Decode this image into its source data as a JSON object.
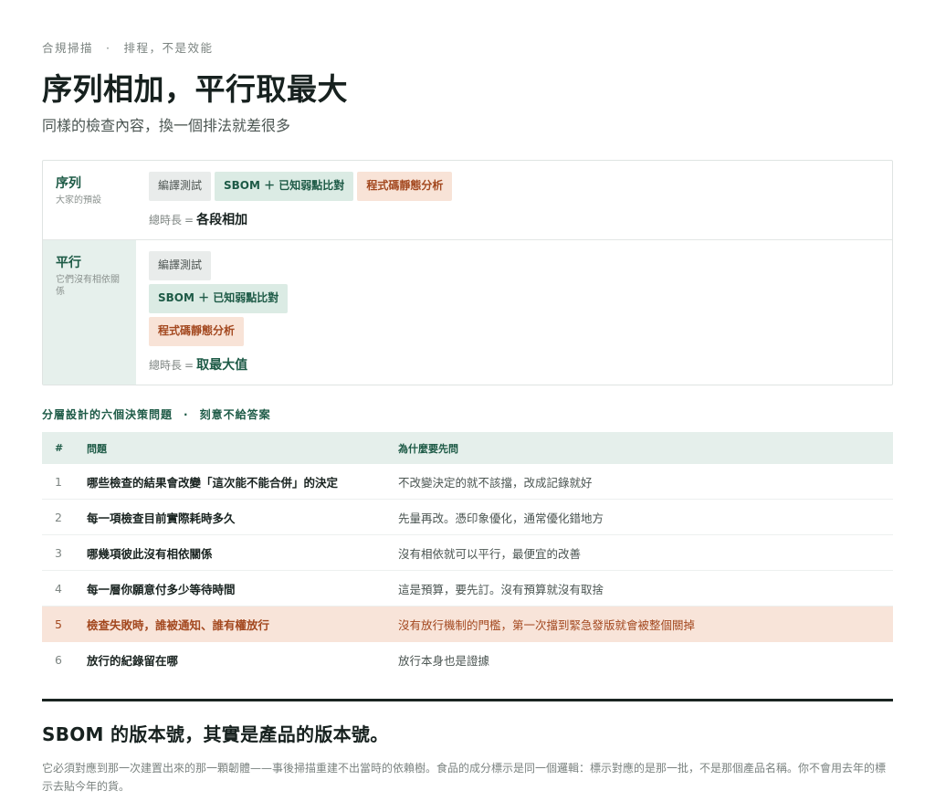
{
  "eyebrow": {
    "left": "合規掃描",
    "separator": "·",
    "right": "排程，不是效能"
  },
  "title": "序列相加，平行取最大",
  "subtitle": "同樣的檢查內容，換一個排法就差很多",
  "comparison": {
    "serial": {
      "label": "序列",
      "sublabel": "大家的預設",
      "chips": [
        "編譯測試",
        "SBOM ＋ 已知弱點比對",
        "程式碼靜態分析"
      ],
      "total_prefix": "總時長",
      "total_eq": "=",
      "total_value": "各段相加"
    },
    "parallel": {
      "label": "平行",
      "sublabel": "它們沒有相依關係",
      "chips": [
        "編譯測試",
        "SBOM ＋ 已知弱點比對",
        "程式碼靜態分析"
      ],
      "total_prefix": "總時長",
      "total_eq": "=",
      "total_value": "取最大值"
    }
  },
  "questions": {
    "heading_left": "分層設計的六個決策問題",
    "heading_sep": "·",
    "heading_right": "刻意不給答案",
    "columns": [
      "#",
      "問題",
      "為什麼要先問"
    ],
    "rows": [
      {
        "num": "1",
        "question": "哪些檢查的結果會改變「這次能不能合併」的決定",
        "why": "不改變決定的就不該擋，改成記錄就好"
      },
      {
        "num": "2",
        "question": "每一項檢查目前實際耗時多久",
        "why": "先量再改。憑印象優化，通常優化錯地方"
      },
      {
        "num": "3",
        "question": "哪幾項彼此沒有相依關係",
        "why": "沒有相依就可以平行，最便宜的改善"
      },
      {
        "num": "4",
        "question": "每一層你願意付多少等待時間",
        "why": "這是預算，要先訂。沒有預算就沒有取捨"
      },
      {
        "num": "5",
        "question": "檢查失敗時，誰被通知、誰有權放行",
        "why": "沒有放行機制的門檻，第一次擋到緊急發版就會被整個關掉"
      },
      {
        "num": "6",
        "question": "放行的紀錄留在哪",
        "why": "放行本身也是證據"
      }
    ]
  },
  "closing": {
    "title": "SBOM 的版本號，其實是產品的版本號。",
    "body": "它必須對應到那一次建置出來的那一顆韌體——事後掃描重建不出當時的依賴樹。食品的成分標示是同一個邏輯：標示對應的是那一批，不是那個產品名稱。你不會用去年的標示去貼今年的貨。"
  },
  "colors": {
    "accent": "#1d5a46",
    "accent_bg": "#e5efeb",
    "warn": "#a3481f",
    "warn_bg": "#f8e4d9",
    "neutral_chip": "#e9eceb"
  }
}
